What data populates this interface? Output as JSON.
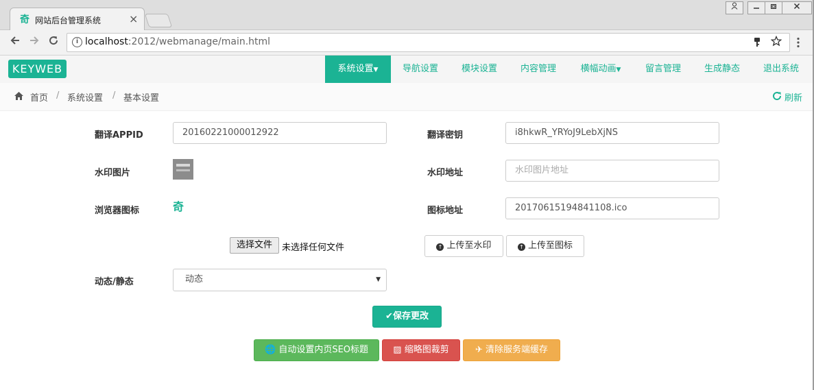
{
  "browser": {
    "tab_title": "网站后台管理系统",
    "tab_close": "×",
    "url_host": "localhost",
    "url_rest": ":2012/webmanage/main.html"
  },
  "app": {
    "logo": "KEYWEB",
    "nav": [
      "系统设置",
      "导航设置",
      "模块设置",
      "内容管理",
      "横幅动画",
      "留言管理",
      "生成静态",
      "退出系统"
    ],
    "breadcrumb": [
      "首页",
      "系统设置",
      "基本设置"
    ],
    "refresh_label": "刷新"
  },
  "form": {
    "appid_label": "翻译APPID",
    "appid_value": "20160221000012922",
    "key_label": "翻译密钥",
    "key_value": "i8hkwR_YRYoJ9LebXjNS",
    "watermark_img_label": "水印图片",
    "watermark_addr_label": "水印地址",
    "watermark_addr_placeholder": "水印图片地址",
    "favicon_label": "浏览器图标",
    "icon_addr_label": "图标地址",
    "icon_addr_value": "20170615194841108.ico",
    "file_button": "选择文件",
    "file_status": "未选择任何文件",
    "upload_watermark": "上传至水印",
    "upload_icon": "上传至图标",
    "mode_label": "动态/静态",
    "mode_value": "动态",
    "save_button": "保存更改",
    "seo_button": "自动设置内页SEO标题",
    "thumb_button": "缩略图裁剪",
    "cache_button": "清除服务端缓存"
  },
  "colors": {
    "brand": "#1bb394",
    "green": "#5cb85c",
    "red": "#d9534f",
    "orange": "#f0ad4e"
  }
}
